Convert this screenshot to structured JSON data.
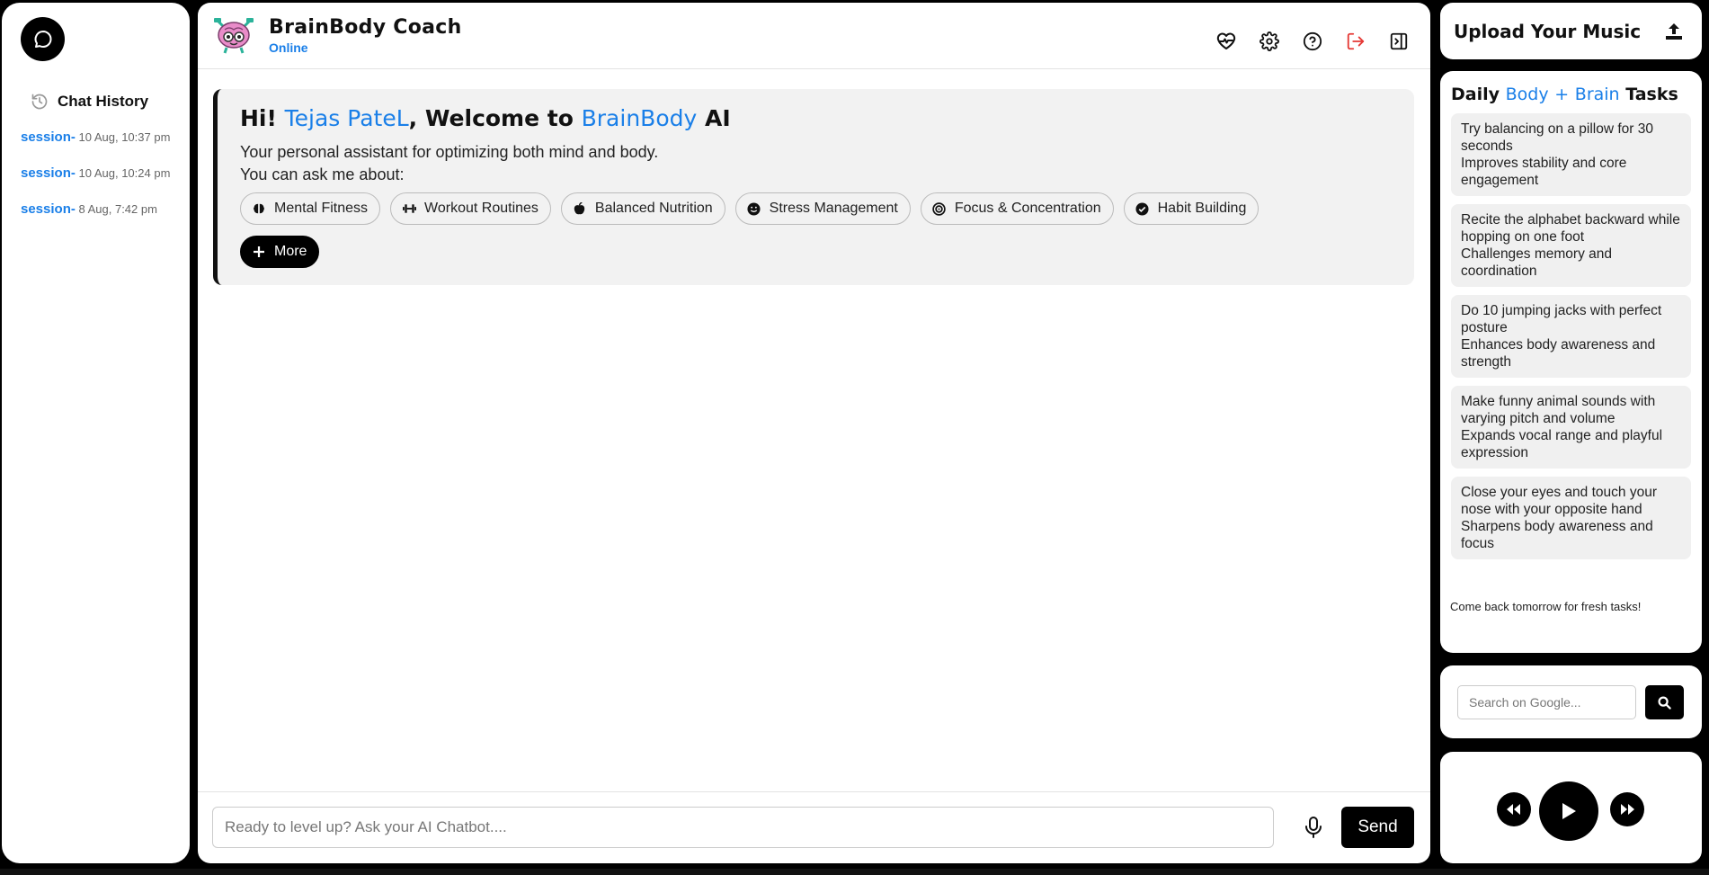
{
  "sidebar": {
    "history_label": "Chat History",
    "sessions": [
      {
        "name": "session-",
        "time": "10 Aug, 10:37 pm"
      },
      {
        "name": "session-",
        "time": "10 Aug, 10:24 pm"
      },
      {
        "name": "session-",
        "time": "8 Aug, 7:42 pm"
      }
    ]
  },
  "header": {
    "title": "BrainBody Coach",
    "status": "Online"
  },
  "welcome": {
    "greeting": "Hi!",
    "user_name": "Tejas PateL",
    "welcome_to": ", Welcome to",
    "brand": "BrainBody",
    "suffix": "AI",
    "line1": "Your personal assistant for optimizing both mind and body.",
    "line2": "You can ask me about:",
    "chips": [
      {
        "label": "Mental Fitness",
        "icon": "brain-icon"
      },
      {
        "label": "Workout Routines",
        "icon": "dumbbell-icon"
      },
      {
        "label": "Balanced Nutrition",
        "icon": "apple-icon"
      },
      {
        "label": "Stress Management",
        "icon": "smile-icon"
      },
      {
        "label": "Focus & Concentration",
        "icon": "target-icon"
      },
      {
        "label": "Habit Building",
        "icon": "check-circle-icon"
      }
    ],
    "more_label": "More"
  },
  "composer": {
    "placeholder": "Ready to level up? Ask your AI Chatbot....",
    "send_label": "Send"
  },
  "upload": {
    "title": "Upload Your Music"
  },
  "tasks": {
    "title_pre": "Daily",
    "title_body": "Body",
    "title_plus": "+",
    "title_brain": "Brain",
    "title_post": "Tasks",
    "items": [
      {
        "task": "Try balancing on a pillow for 30 seconds",
        "benefit": "Improves stability and core engagement"
      },
      {
        "task": "Recite the alphabet backward while hopping on one foot",
        "benefit": "Challenges memory and coordination"
      },
      {
        "task": "Do 10 jumping jacks with perfect posture",
        "benefit": "Enhances body awareness and strength"
      },
      {
        "task": "Make funny animal sounds with varying pitch and volume",
        "benefit": "Expands vocal range and playful expression"
      },
      {
        "task": "Close your eyes and touch your nose with your opposite hand",
        "benefit": "Sharpens body awareness and focus"
      }
    ],
    "footer": "Come back tomorrow for fresh tasks!"
  },
  "search": {
    "placeholder": "Search on Google..."
  },
  "colors": {
    "accent": "#1a7fe8",
    "logout": "#e53935",
    "dark": "#000000"
  }
}
